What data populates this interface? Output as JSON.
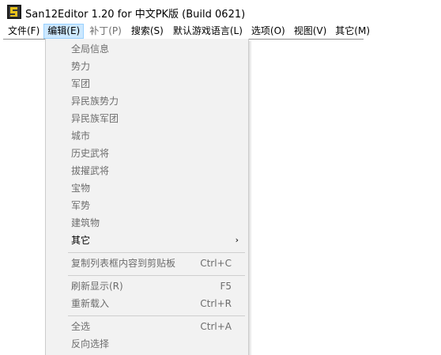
{
  "window": {
    "title": "San12Editor 1.20 for 中文PK版 (Build 0621)"
  },
  "menubar": {
    "items": [
      {
        "label": "文件(F)",
        "state": "normal"
      },
      {
        "label": "编辑(E)",
        "state": "active"
      },
      {
        "label": "补丁(P)",
        "state": "disabled"
      },
      {
        "label": "搜索(S)",
        "state": "normal"
      },
      {
        "label": "默认游戏语言(L)",
        "state": "normal"
      },
      {
        "label": "选项(O)",
        "state": "normal"
      },
      {
        "label": "视图(V)",
        "state": "normal"
      },
      {
        "label": "其它(M)",
        "state": "normal"
      }
    ]
  },
  "edit_menu": {
    "items": [
      {
        "label": "全局信息",
        "shortcut": "",
        "enabled": false
      },
      {
        "label": "势力",
        "shortcut": "",
        "enabled": false
      },
      {
        "label": "军团",
        "shortcut": "",
        "enabled": false
      },
      {
        "label": "异民族势力",
        "shortcut": "",
        "enabled": false
      },
      {
        "label": "异民族军团",
        "shortcut": "",
        "enabled": false
      },
      {
        "label": "城市",
        "shortcut": "",
        "enabled": false
      },
      {
        "label": "历史武将",
        "shortcut": "",
        "enabled": false
      },
      {
        "label": "拔擢武将",
        "shortcut": "",
        "enabled": false
      },
      {
        "label": "宝物",
        "shortcut": "",
        "enabled": false
      },
      {
        "label": "军势",
        "shortcut": "",
        "enabled": false
      },
      {
        "label": "建筑物",
        "shortcut": "",
        "enabled": false
      },
      {
        "label": "其它",
        "shortcut": "",
        "enabled": true,
        "submenu": true,
        "arrow": "›"
      },
      {
        "label": "复制列表框内容到剪贴板",
        "shortcut": "Ctrl+C",
        "enabled": false
      },
      {
        "label": "刷新显示(R)",
        "shortcut": "F5",
        "enabled": false
      },
      {
        "label": "重新载入",
        "shortcut": "Ctrl+R",
        "enabled": false
      },
      {
        "label": "全选",
        "shortcut": "Ctrl+A",
        "enabled": false
      },
      {
        "label": "反向选择",
        "shortcut": "",
        "enabled": false
      }
    ]
  },
  "colors": {
    "menu_bg": "#f2f2f2",
    "disabled_text": "#6d6d6d",
    "active_menu_bg": "#cce8ff",
    "active_menu_border": "#99d1ff"
  },
  "icons": {
    "app": "san12-app-icon",
    "submenu": "chevron-right-icon"
  }
}
